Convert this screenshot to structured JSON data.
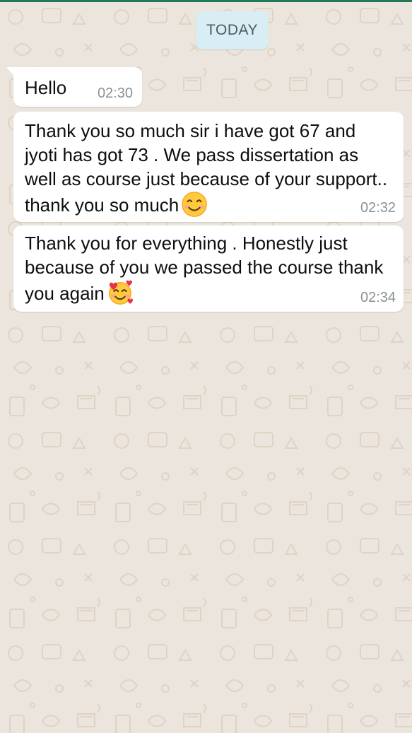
{
  "chat": {
    "date_label": "TODAY",
    "messages": [
      {
        "text": "Hello",
        "time": "02:30"
      },
      {
        "text": "Thank you so much sir i have got 67 and jyoti has got 73 . We pass dissertation as well as course just because of your support.. thank you so much",
        "emoji": "smiling-face-with-smiling-eyes",
        "time": "02:32"
      },
      {
        "text": "Thank you for everything . Honestly just because of you we passed the course thank you again",
        "emoji": "smiling-face-with-hearts",
        "time": "02:34"
      }
    ]
  },
  "colors": {
    "wallpaper": "#ece5dd",
    "bubble": "#ffffff",
    "date_chip": "#d9edf4",
    "timestamp": "#8b9293"
  }
}
